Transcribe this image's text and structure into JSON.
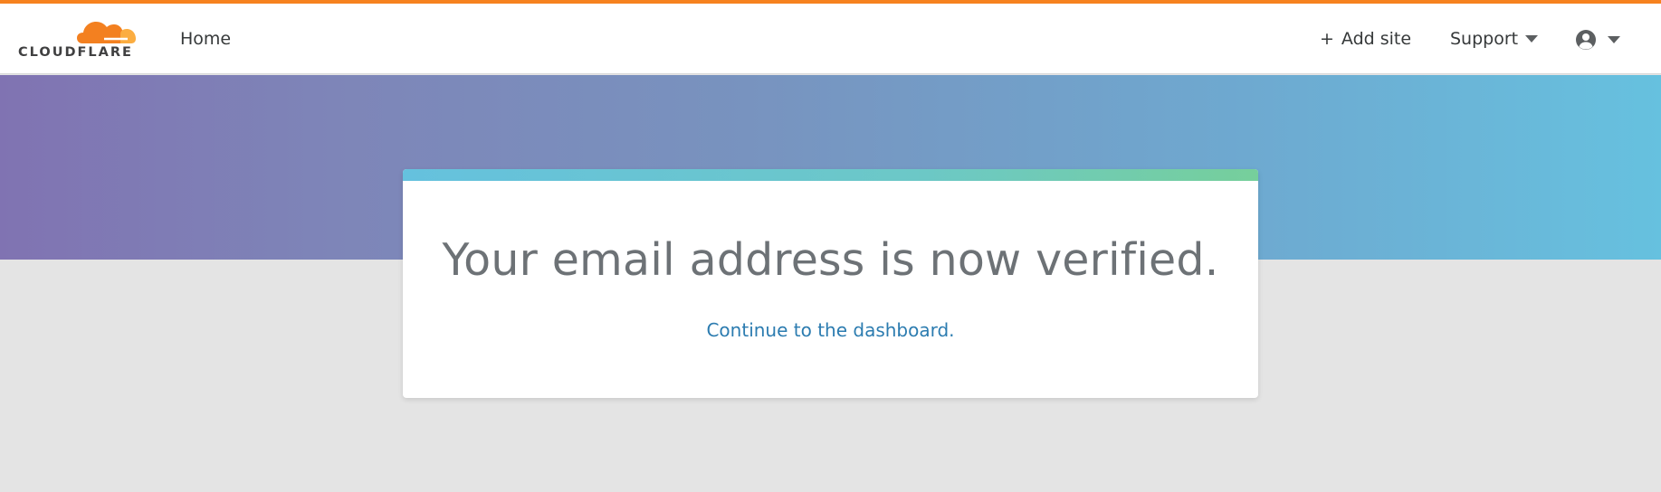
{
  "brand": {
    "logo_text": "CLOUDFLARE",
    "logo_icon": "cloudflare-cloud-logo",
    "accent_color": "#f6821f"
  },
  "navbar": {
    "home_label": "Home",
    "add_site_label": "Add site",
    "add_site_icon": "plus-icon",
    "support_label": "Support",
    "account_icon": "user-circle-icon"
  },
  "card": {
    "title": "Your email address is now verified.",
    "link_label": "Continue to the dashboard.",
    "link_color": "#2c7cb0"
  }
}
